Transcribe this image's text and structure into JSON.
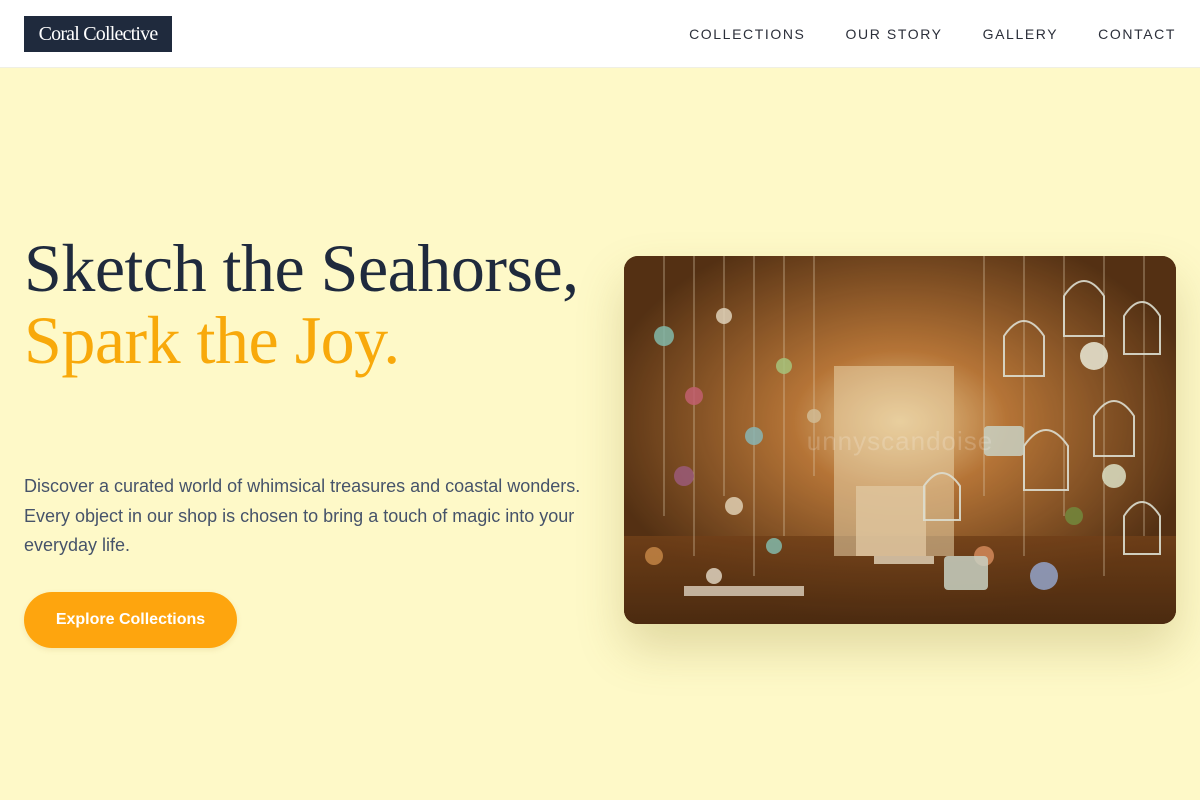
{
  "brand": {
    "name": "Coral Collective"
  },
  "nav": {
    "items": [
      "COLLECTIONS",
      "OUR STORY",
      "GALLERY",
      "CONTACT"
    ]
  },
  "hero": {
    "title_main": "Sketch the Seahorse,",
    "title_accent": "Spark the Joy.",
    "description": "Discover a curated world of whimsical treasures and coastal wonders. Every object in our shop is chosen to bring a touch of magic into your everyday life.",
    "cta_label": "Explore Collections",
    "image_watermark": "unnyscandoise"
  },
  "colors": {
    "background": "#fef9c8",
    "dark": "#1f2a3d",
    "accent": "#f8a90b",
    "button": "#fea50e",
    "body_text": "#46536a"
  }
}
